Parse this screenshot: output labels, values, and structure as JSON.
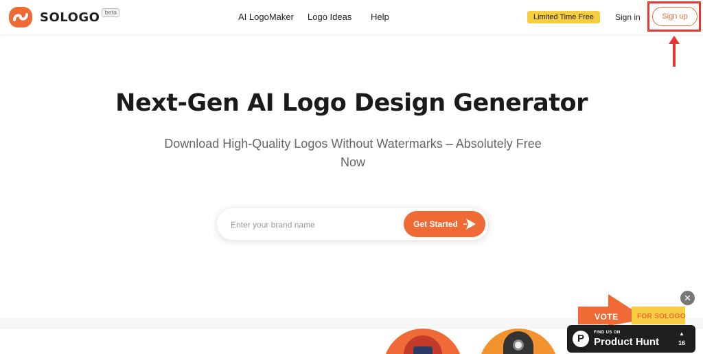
{
  "header": {
    "brand_name": "SOLOGO",
    "brand_badge": "beta",
    "nav": {
      "ai_logomaker": "AI LogoMaker",
      "logo_ideas": "Logo Ideas",
      "help": "Help"
    },
    "promo_badge": "Limited Time Free",
    "sign_in": "Sign in",
    "sign_up": "Sign up"
  },
  "hero": {
    "title": "Next-Gen AI Logo Design Generator",
    "subtitle": "Download High-Quality Logos Without Watermarks – Absolutely Free Now"
  },
  "search": {
    "placeholder": "Enter your brand name",
    "button_label": "Get Started"
  },
  "product_hunt": {
    "vote": "VOTE",
    "for_label": "FOR SOLOGO",
    "find_us": "FIND US ON",
    "name": "Product Hunt",
    "upvote_count": "16",
    "close": "✕"
  },
  "colors": {
    "brand_orange": "#f06a35",
    "promo_yellow": "#f6ce3f",
    "highlight_red": "#e53535",
    "ph_dark": "#1e1e1e"
  },
  "icons": {
    "brand_logo": "sologo-logo-icon",
    "send": "send-arrow-icon",
    "annotation_arrow": "red-up-arrow-icon",
    "ph_logo": "product-hunt-logo-icon",
    "upvote": "upvote-triangle-icon",
    "close": "close-icon"
  }
}
